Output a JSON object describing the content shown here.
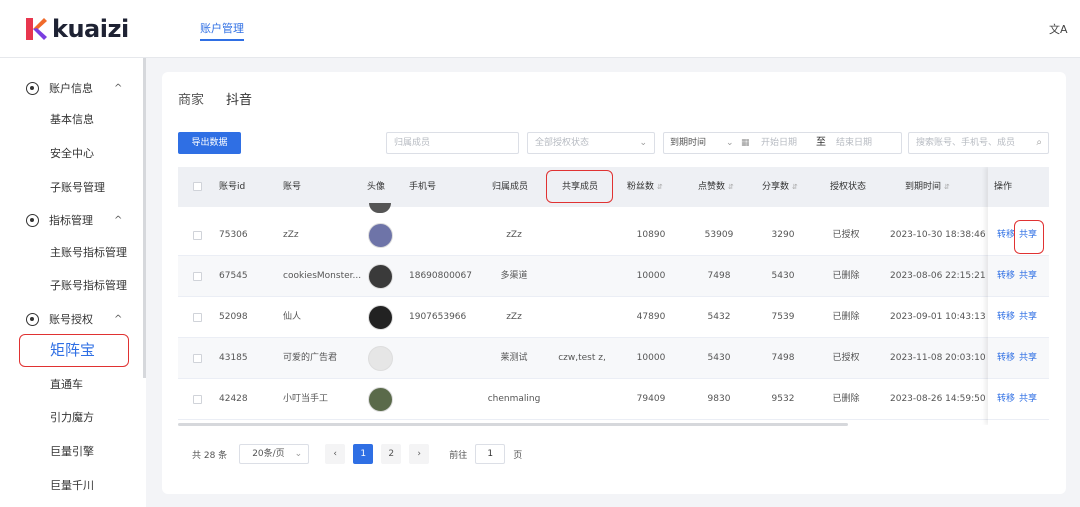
{
  "header": {
    "logo_text": "kuaizi",
    "nav_active": "账户管理",
    "lang_icon_text": "文A"
  },
  "sidebar": {
    "groups": [
      {
        "label": "账户信息",
        "items": [
          "基本信息",
          "安全中心",
          "子账号管理"
        ]
      },
      {
        "label": "指标管理",
        "items": [
          "主账号指标管理",
          "子账号指标管理"
        ]
      },
      {
        "label": "账号授权",
        "items": [
          "矩阵宝",
          "直通车",
          "引力魔方",
          "巨量引擎",
          "巨量千川"
        ]
      }
    ],
    "active_item": "矩阵宝",
    "caret": "^"
  },
  "main": {
    "breadcrumbs": [
      "商家",
      "抖音"
    ],
    "export_button": "导出数据",
    "filters": {
      "member_placeholder": "归属成员",
      "auth_status_placeholder": "全部授权状态",
      "date_type": "到期时间",
      "start_date_placeholder": "开始日期",
      "date_separator": "至",
      "end_date_placeholder": "结束日期",
      "search_placeholder": "搜索账号、手机号、成员"
    },
    "table": {
      "headers": [
        "账号id",
        "账号",
        "头像",
        "手机号",
        "归属成员",
        "共享成员",
        "粉丝数",
        "点赞数",
        "分享数",
        "授权状态",
        "到期时间",
        "操作"
      ],
      "rows": [
        {
          "id": "75306",
          "account": "zZz",
          "phone": "",
          "owner": "zZz",
          "shared": "",
          "fans": "10890",
          "likes": "53909",
          "shares": "3290",
          "status": "已授权",
          "expire": "2023-10-30 18:38:46",
          "avatar_color": "#6e74a8"
        },
        {
          "id": "67545",
          "account": "cookiesMonster...",
          "phone": "18690800067",
          "owner": "多渠道",
          "shared": "",
          "fans": "10000",
          "likes": "7498",
          "shares": "5430",
          "status": "已删除",
          "expire": "2023-08-06 22:15:21",
          "avatar_color": "#3a3a3a"
        },
        {
          "id": "52098",
          "account": "仙人",
          "phone": "1907653966",
          "owner": "zZz",
          "shared": "",
          "fans": "47890",
          "likes": "5432",
          "shares": "7539",
          "status": "已删除",
          "expire": "2023-09-01 10:43:13",
          "avatar_color": "#222222"
        },
        {
          "id": "43185",
          "account": "可爱的广告君",
          "phone": "",
          "owner": "莱测试",
          "shared": "czw,test z,",
          "fans": "10000",
          "likes": "5430",
          "shares": "7498",
          "status": "已授权",
          "expire": "2023-11-08 20:03:10",
          "avatar_color": "#e6e6e6"
        },
        {
          "id": "42428",
          "account": "小叮当手工",
          "phone": "",
          "owner": "chenmaling",
          "shared": "",
          "fans": "79409",
          "likes": "9830",
          "shares": "9532",
          "status": "已删除",
          "expire": "2023-08-26 14:59:50",
          "avatar_color": "#5a6a4a"
        }
      ],
      "actions": {
        "transfer": "转移",
        "share": "共享"
      }
    },
    "pagination": {
      "total": "共 28 条",
      "page_size": "20条/页",
      "pages": [
        "1",
        "2"
      ],
      "current_page": "1",
      "goto_label": "前往",
      "goto_value": "1",
      "goto_suffix": "页"
    }
  }
}
